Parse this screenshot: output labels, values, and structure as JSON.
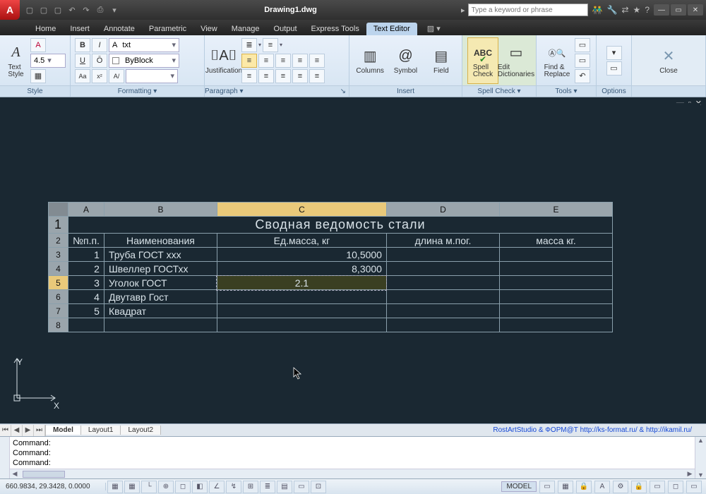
{
  "title": "Drawing1.dwg",
  "search_placeholder": "Type a keyword or phrase",
  "menus": [
    "Home",
    "Insert",
    "Annotate",
    "Parametric",
    "View",
    "Manage",
    "Output",
    "Express Tools",
    "Text Editor"
  ],
  "active_menu": 8,
  "ribbon": {
    "style": {
      "title": "Style",
      "text_style_label": "Text\nStyle",
      "font_size": "4.5"
    },
    "formatting": {
      "title": "Formatting ▾",
      "layer": "txt",
      "color": "ByBlock"
    },
    "paragraph": {
      "title": "Paragraph ▾",
      "justification": "Justification"
    },
    "insert": {
      "title": "Insert",
      "columns": "Columns",
      "symbol": "Symbol",
      "field": "Field"
    },
    "spellcheck": {
      "title": "Spell Check ▾",
      "spell": "Spell\nCheck",
      "dict": "Edit\nDictionaries"
    },
    "tools": {
      "title": "Tools ▾",
      "find": "Find &\nReplace"
    },
    "options": {
      "title": "Options"
    },
    "close": {
      "title": "",
      "label": "Close"
    }
  },
  "table": {
    "columns": [
      "A",
      "B",
      "C",
      "D",
      "E"
    ],
    "title": "Сводная ведомость стали",
    "headers": {
      "num": "№п.п.",
      "name": "Наименования",
      "mass_unit": "Ед.масса, кг",
      "length": "длина м.пог.",
      "mass": "масса кг."
    },
    "rows": [
      {
        "n": "1",
        "name": "Труба ГОСТ ххх",
        "m": "10,5000"
      },
      {
        "n": "2",
        "name": "Швеллер ГОСТхх",
        "m": "8,3000"
      },
      {
        "n": "3",
        "name": "Уголок ГОСТ",
        "m": "2.1"
      },
      {
        "n": "4",
        "name": "Двутавр Гост",
        "m": ""
      },
      {
        "n": "5",
        "name": "Квадрат",
        "m": ""
      }
    ],
    "editing_row": 2,
    "selected_col": 2
  },
  "layout_tabs": [
    "Model",
    "Layout1",
    "Layout2"
  ],
  "credit": "RostArtStudio & ФОРМ@Т http://ks-format.ru/ & http://ikamil.ru/",
  "cmd_lines": [
    "Command:",
    "Command:",
    "Command:"
  ],
  "coords": "660.9834, 29.3428, 0.0000",
  "status_model": "MODEL"
}
